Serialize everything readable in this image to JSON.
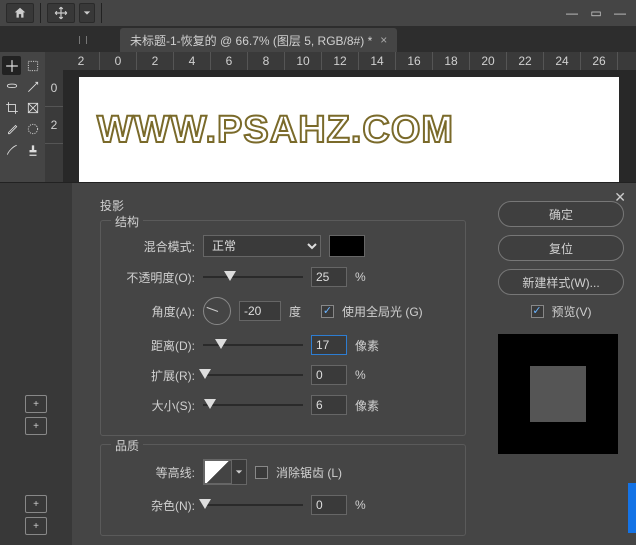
{
  "topbar": {
    "home_icon": "home",
    "move_icon": "move"
  },
  "tab": {
    "title": "未标题-1-恢复的 @ 66.7% (图层 5, RGB/8#) *"
  },
  "ruler": {
    "h": [
      "2",
      "0",
      "2",
      "4",
      "6",
      "8",
      "10",
      "12",
      "14",
      "16",
      "18",
      "20",
      "22",
      "24",
      "26"
    ],
    "v": [
      "0",
      "2"
    ]
  },
  "canvas_text": "WWW.PSAHZ.COM",
  "dialog": {
    "effect_name": "投影",
    "section_structure": "结构",
    "section_quality": "品质",
    "blend_mode_label": "混合模式:",
    "blend_mode_value": "正常",
    "opacity_label": "不透明度(O):",
    "opacity_value": "25",
    "opacity_unit": "%",
    "angle_label": "角度(A):",
    "angle_value": "-20",
    "angle_unit": "度",
    "global_light_label": "使用全局光 (G)",
    "distance_label": "距离(D):",
    "distance_value": "17",
    "distance_unit": "像素",
    "spread_label": "扩展(R):",
    "spread_value": "0",
    "spread_unit": "%",
    "size_label": "大小(S):",
    "size_value": "6",
    "size_unit": "像素",
    "contour_label": "等高线:",
    "antialias_label": "消除锯齿 (L)",
    "noise_label": "杂色(N):",
    "noise_value": "0",
    "noise_unit": "%"
  },
  "buttons": {
    "ok": "确定",
    "cancel": "复位",
    "new_style": "新建样式(W)...",
    "preview": "预览(V)"
  }
}
